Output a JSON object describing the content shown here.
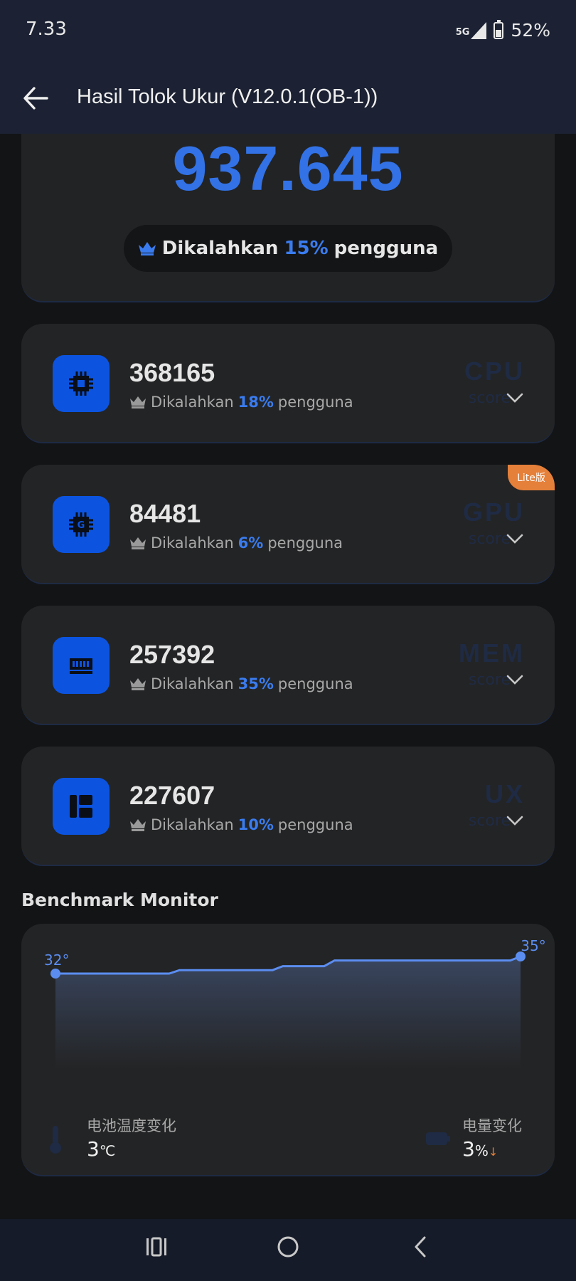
{
  "status_bar": {
    "time": "7.33",
    "network": "5G",
    "battery": "52%",
    "battery_level": 0.52
  },
  "app_bar": {
    "title": "Hasil Tolok Ukur (V12.0.1(OB-1))",
    "back_icon": "arrow-left-icon"
  },
  "total": {
    "score": "937.645",
    "beaten_prefix": "Dikalahkan",
    "beaten_percent": "15%",
    "beaten_suffix": "pengguna",
    "icon": "crown-icon"
  },
  "cards": [
    {
      "id": "cpu",
      "icon": "cpu-chip-icon",
      "value": "368165",
      "prefix": "Dikalahkan",
      "percent": "18%",
      "suffix": "pengguna",
      "tag": "CPU",
      "tag_sub": "score"
    },
    {
      "id": "gpu",
      "icon": "gpu-chip-icon",
      "value": "84481",
      "prefix": "Dikalahkan",
      "percent": "6%",
      "suffix": "pengguna",
      "tag": "GPU",
      "tag_sub": "score",
      "badge": "Lite版"
    },
    {
      "id": "mem",
      "icon": "memory-icon",
      "value": "257392",
      "prefix": "Dikalahkan",
      "percent": "35%",
      "suffix": "pengguna",
      "tag": "MEM",
      "tag_sub": "score"
    },
    {
      "id": "ux",
      "icon": "ux-layout-icon",
      "value": "227607",
      "prefix": "Dikalahkan",
      "percent": "10%",
      "suffix": "pengguna",
      "tag": "UX",
      "tag_sub": "score"
    }
  ],
  "monitor": {
    "title": "Benchmark Monitor",
    "start_label": "32°",
    "end_label": "35°",
    "temperature_series": [
      32,
      32,
      32,
      32,
      32,
      32,
      32,
      32,
      32,
      32,
      32,
      32,
      32.6,
      32.6,
      32.6,
      32.6,
      32.6,
      32.6,
      32.6,
      32.6,
      32.6,
      32.6,
      33.3,
      33.3,
      33.3,
      33.3,
      33.3,
      34.3,
      34.3,
      34.3,
      34.3,
      34.3,
      34.3,
      34.3,
      34.3,
      34.3,
      34.3,
      34.3,
      34.3,
      34.3,
      34.3,
      34.3,
      34.3,
      34.3,
      34.3,
      35
    ],
    "accent": "#5b8df0",
    "battery_temp_label": "电池温度变化",
    "battery_temp_value": "3",
    "battery_temp_unit": "℃",
    "battery_level_label": "电量变化",
    "battery_level_value": "3",
    "battery_level_unit": "%",
    "battery_level_trend": "↓"
  },
  "nav": {
    "recents": "recents-icon",
    "home": "home-icon",
    "back": "back-chevron-icon"
  },
  "colors": {
    "accent": "#3a7cf0",
    "icon_bg": "#0c54e0",
    "badge": "#e5803a",
    "card": "#232425",
    "background": "#121416"
  }
}
